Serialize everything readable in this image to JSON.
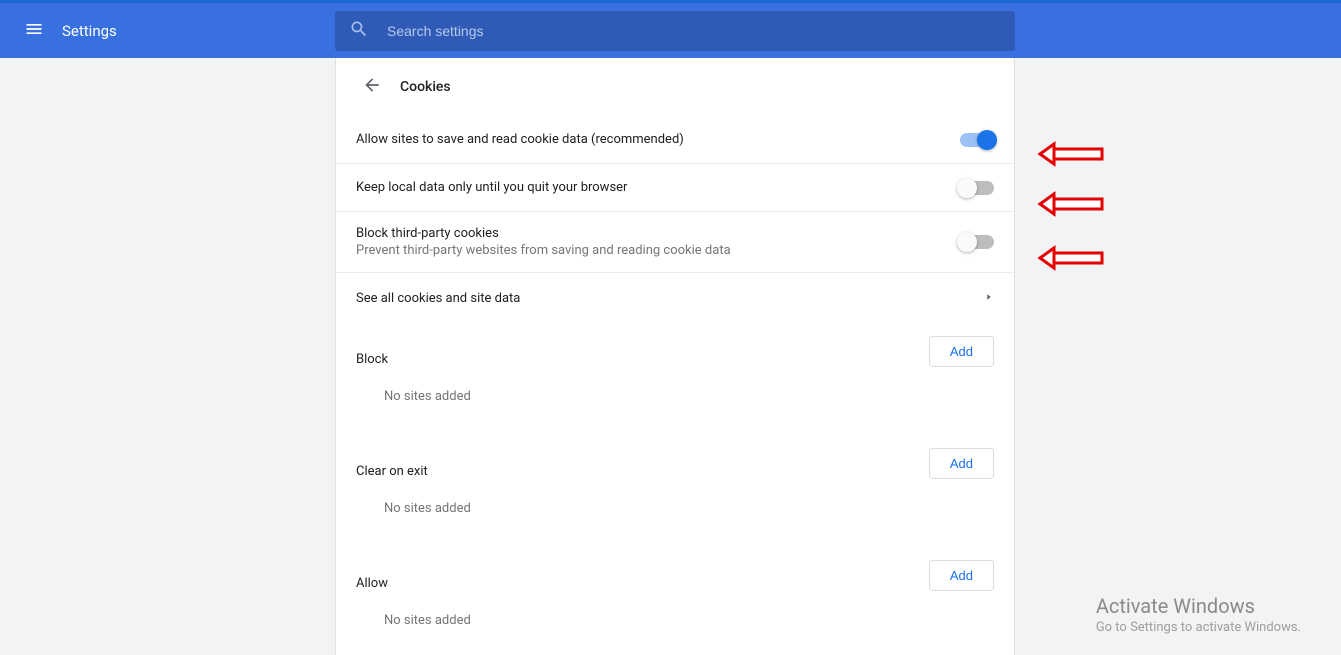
{
  "header": {
    "title": "Settings"
  },
  "search": {
    "placeholder": "Search settings"
  },
  "page": {
    "title": "Cookies",
    "rows": {
      "allow": {
        "label": "Allow sites to save and read cookie data (recommended)",
        "on": true
      },
      "keep": {
        "label": "Keep local data only until you quit your browser",
        "on": false
      },
      "block3p": {
        "label": "Block third-party cookies",
        "sub": "Prevent third-party websites from saving and reading cookie data",
        "on": false
      },
      "seeall": {
        "label": "See all cookies and site data"
      }
    },
    "sections": {
      "block": {
        "label": "Block",
        "add": "Add",
        "empty": "No sites added"
      },
      "clear": {
        "label": "Clear on exit",
        "add": "Add",
        "empty": "No sites added"
      },
      "allowList": {
        "label": "Allow",
        "add": "Add",
        "empty": "No sites added"
      }
    }
  },
  "watermark": {
    "title": "Activate Windows",
    "sub": "Go to Settings to activate Windows."
  }
}
